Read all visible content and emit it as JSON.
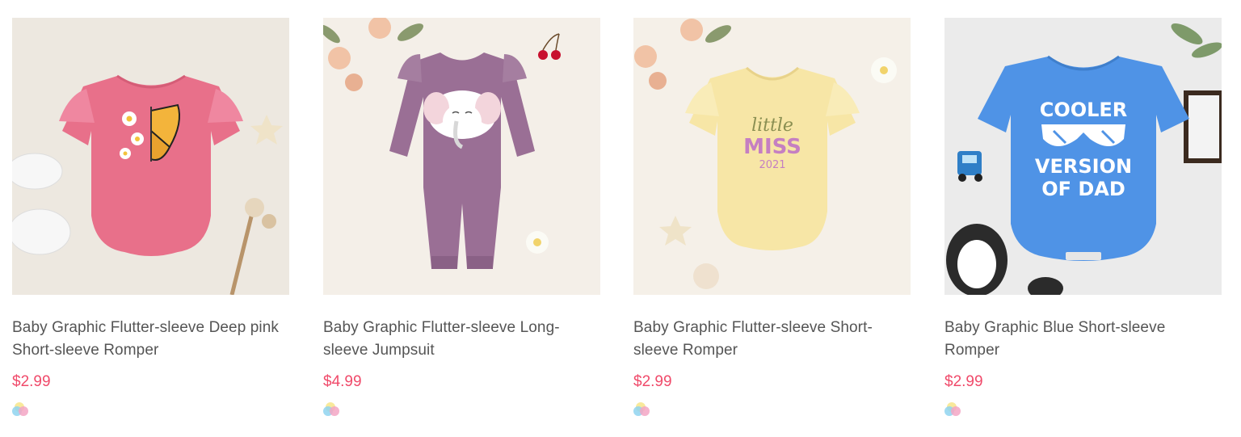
{
  "products": [
    {
      "title": "Baby Graphic Flutter-sleeve Deep pink Short-sleeve Romper",
      "price": "$2.99",
      "bg": "#ede8e0",
      "garment": "#e8708a"
    },
    {
      "title": "Baby Graphic Flutter-sleeve Long-sleeve Jumpsuit",
      "price": "$4.99",
      "bg": "#f4efe8",
      "garment": "#9a6f95"
    },
    {
      "title": "Baby Graphic Flutter-sleeve Short-sleeve Romper",
      "price": "$2.99",
      "bg": "#f5f0e8",
      "garment": "#f7e6a6",
      "print_line1": "little",
      "print_line2": "MISS",
      "print_line3": "2021"
    },
    {
      "title": "Baby Graphic Blue Short-sleeve Romper",
      "price": "$2.99",
      "bg": "#ebebeb",
      "garment": "#4f93e6",
      "print_line1": "COOLER",
      "print_line2": "VERSION",
      "print_line3": "OF DAD"
    }
  ],
  "swatch_colors": [
    "#f7e58a",
    "#8fd3f0",
    "#f3a6c4"
  ],
  "price_color": "#f04a6a"
}
